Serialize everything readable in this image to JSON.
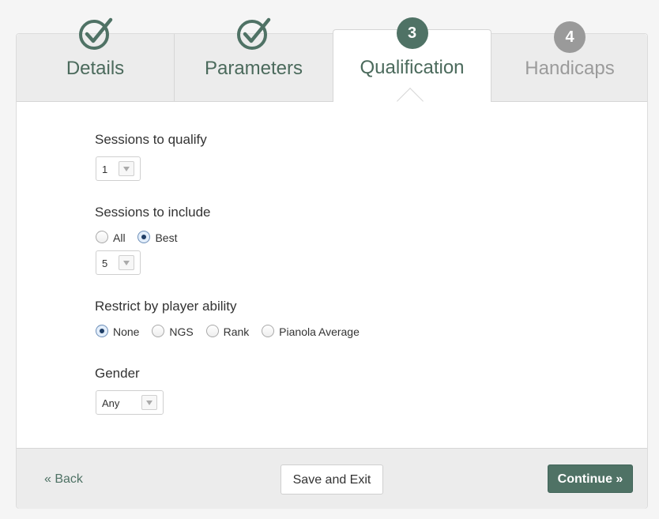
{
  "tabs": [
    {
      "label": "Details",
      "state": "complete"
    },
    {
      "label": "Parameters",
      "state": "complete"
    },
    {
      "label": "Qualification",
      "state": "active",
      "number": "3"
    },
    {
      "label": "Handicaps",
      "state": "future",
      "number": "4"
    }
  ],
  "form": {
    "sessions_to_qualify": {
      "label": "Sessions to qualify",
      "value": "1"
    },
    "sessions_to_include": {
      "label": "Sessions to include",
      "options": [
        "All",
        "Best"
      ],
      "selected": "Best",
      "count_value": "5"
    },
    "restrict_by_ability": {
      "label": "Restrict by player ability",
      "options": [
        "None",
        "NGS",
        "Rank",
        "Pianola Average"
      ],
      "selected": "None"
    },
    "gender": {
      "label": "Gender",
      "value": "Any"
    }
  },
  "footer": {
    "back_label": "« Back",
    "save_label": "Save and Exit",
    "continue_label": "Continue »"
  },
  "colors": {
    "accent": "#4f7265",
    "future": "#9a9a9a"
  }
}
